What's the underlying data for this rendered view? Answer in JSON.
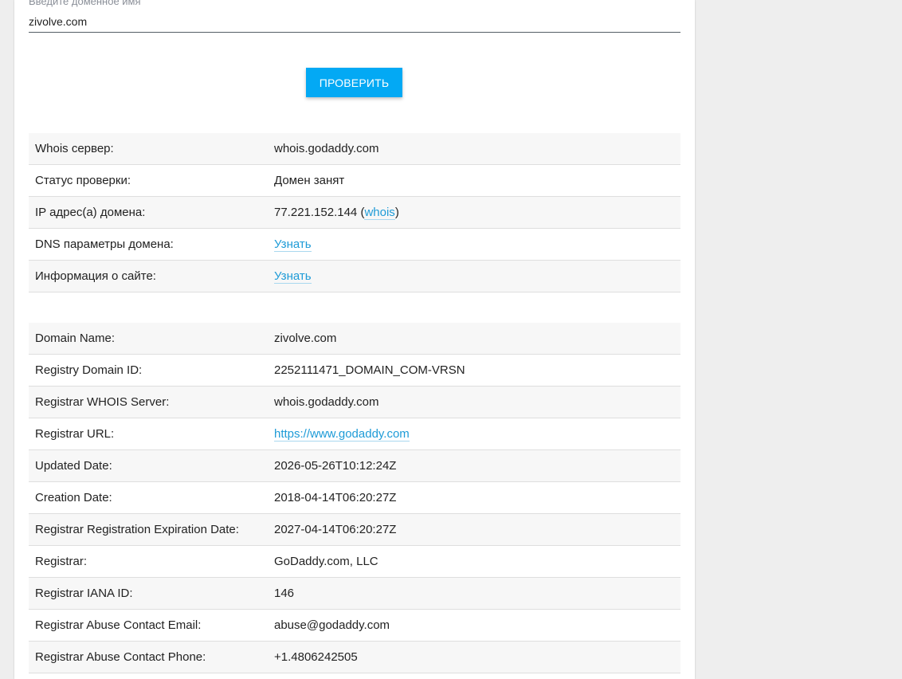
{
  "form": {
    "domain_label": "Введите доменное имя",
    "domain_value": "zivolve.com",
    "check_button": "ПРОВЕРИТЬ"
  },
  "summary": [
    {
      "key": "Whois сервер:",
      "value": "whois.godaddy.com"
    },
    {
      "key": "Статус проверки:",
      "value": "Домен занят"
    },
    {
      "key": "IP адрес(а) домена:",
      "value": "77.221.152.144",
      "link": "whois"
    },
    {
      "key": "DNS параметры домена:",
      "link": "Узнать"
    },
    {
      "key": "Информация о сайте:",
      "link": "Узнать"
    }
  ],
  "whois": [
    {
      "key": "Domain Name:",
      "value": "zivolve.com"
    },
    {
      "key": "Registry Domain ID:",
      "value": "2252111471_DOMAIN_COM-VRSN"
    },
    {
      "key": "Registrar WHOIS Server:",
      "value": "whois.godaddy.com"
    },
    {
      "key": "Registrar URL:",
      "link": "https://www.godaddy.com"
    },
    {
      "key": "Updated Date:",
      "value": "2026-05-26T10:12:24Z"
    },
    {
      "key": "Creation Date:",
      "value": "2018-04-14T06:20:27Z"
    },
    {
      "key": "Registrar Registration Expiration Date:",
      "value": "2027-04-14T06:20:27Z"
    },
    {
      "key": "Registrar:",
      "value": "GoDaddy.com, LLC"
    },
    {
      "key": "Registrar IANA ID:",
      "value": "146"
    },
    {
      "key": "Registrar Abuse Contact Email:",
      "value": "abuse@godaddy.com"
    },
    {
      "key": "Registrar Abuse Contact Phone:",
      "value": "+1.4806242505"
    }
  ],
  "colors": {
    "accent": "#03a9f4",
    "link": "#1e9bd7",
    "page_bg": "#eeeeee"
  }
}
